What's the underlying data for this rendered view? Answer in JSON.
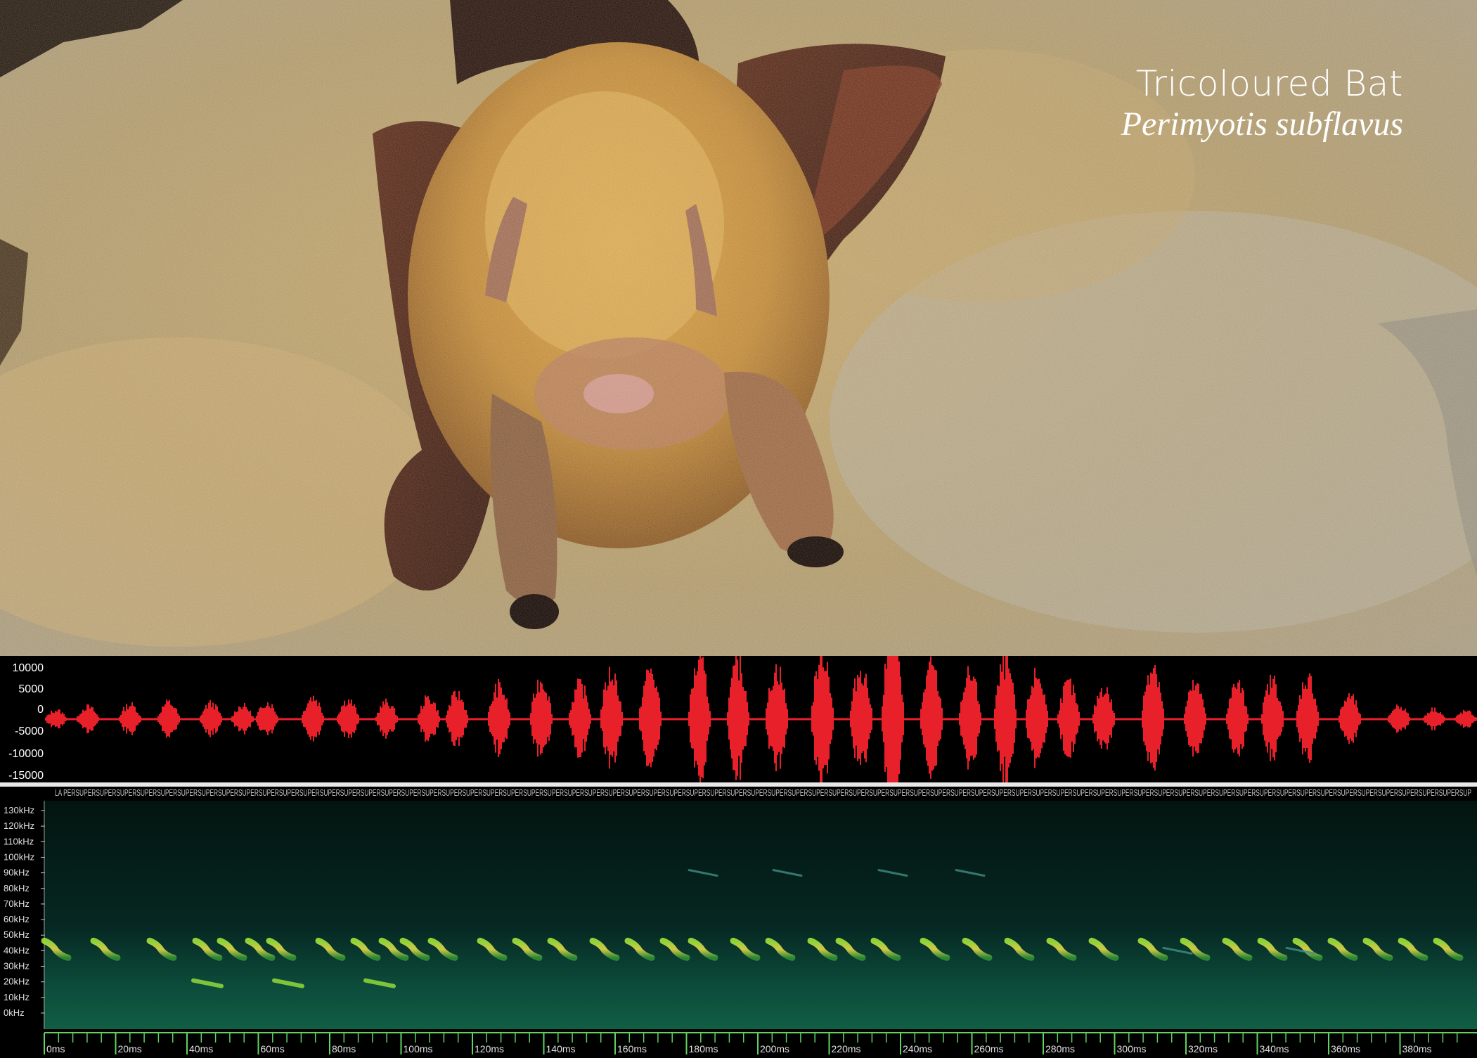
{
  "title": {
    "common_name": "Tricoloured Bat",
    "scientific_name": "Perimyotis subflavus"
  },
  "waveform": {
    "y_ticks": [
      "10000",
      "5000",
      "0",
      "-5000",
      "-10000",
      "-15000"
    ],
    "color": "#e8202a"
  },
  "spectrogram": {
    "label_strip": "LA PERSUPERSUPERSUPERSUPERSUPERSUPERSUPERSUPERSUPERSUPERSUPERSUPERSUPERSUPERSUPERSUPERSUPERSUPERSUPERSUPERSUPERSUPERSUPERSUPERSUPERSUPERSUPERSUPERSUPERSUPERSUPERSUPERSUPERSUPERSUPERSUPERSUPERSUPERSUPERSUPERSUPERSUPERSUPERSUPERSUPERSUPERSUPERSUPERSUPERSUPERSUPERSUPERSUPERSUPERSUPERSUPERSUPERSUPERSUPERSUPERSUPERSUPERSUPERSUPERSUPERSUPERSUPERSUPERSUP",
    "freq_ticks": [
      "130kHz",
      "120kHz",
      "110kHz",
      "100kHz",
      "90kHz",
      "80kHz",
      "70kHz",
      "60kHz",
      "50kHz",
      "40kHz",
      "30kHz",
      "20kHz",
      "10kHz",
      "0kHz"
    ],
    "time_ticks": [
      "0ms",
      "20ms",
      "40ms",
      "60ms",
      "80ms",
      "100ms",
      "120ms",
      "140ms",
      "160ms",
      "180ms",
      "200ms",
      "220ms",
      "240ms",
      "260ms",
      "280ms",
      "300ms",
      "320ms",
      "340ms",
      "360ms",
      "380ms"
    ],
    "axis_color": "#5fd35f",
    "call_color": "#7ed321"
  }
}
